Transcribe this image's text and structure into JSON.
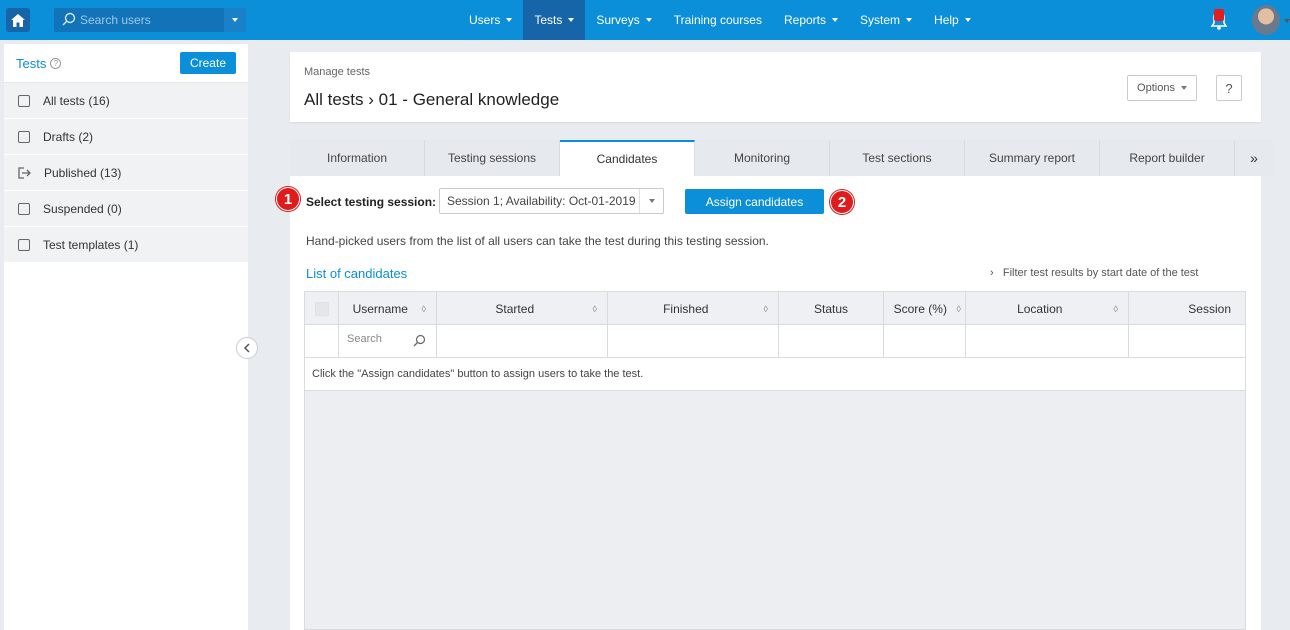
{
  "topbar": {
    "search_placeholder": "Search users",
    "nav": [
      {
        "label": "Users",
        "dropdown": true,
        "active": false
      },
      {
        "label": "Tests",
        "dropdown": true,
        "active": true
      },
      {
        "label": "Surveys",
        "dropdown": true,
        "active": false
      },
      {
        "label": "Training courses",
        "dropdown": false,
        "active": false
      },
      {
        "label": "Reports",
        "dropdown": true,
        "active": false
      },
      {
        "label": "System",
        "dropdown": true,
        "active": false
      },
      {
        "label": "Help",
        "dropdown": true,
        "active": false
      }
    ],
    "colors": {
      "bar": "#0a8fd8",
      "active": "#1565a8",
      "notification": "#e02020"
    }
  },
  "sidebar": {
    "title": "Tests",
    "create_label": "Create",
    "items": [
      {
        "label": "All tests (16)",
        "icon": "all-tests-icon"
      },
      {
        "label": "Drafts (2)",
        "icon": "pencil-icon"
      },
      {
        "label": "Published (13)",
        "icon": "publish-icon"
      },
      {
        "label": "Suspended (0)",
        "icon": "pause-icon"
      },
      {
        "label": "Test templates (1)",
        "icon": "template-icon"
      }
    ]
  },
  "header": {
    "breadcrumb_small": "Manage tests",
    "breadcrumb_parent": "All tests",
    "breadcrumb_separator": "›",
    "breadcrumb_current": "01 - General knowledge",
    "options_label": "Options",
    "help_label": "?"
  },
  "tabs": {
    "items": [
      "Information",
      "Testing sessions",
      "Candidates",
      "Monitoring",
      "Test sections",
      "Summary report",
      "Report builder"
    ],
    "active": "Candidates",
    "more_label": "»"
  },
  "candidates": {
    "badge1": "1",
    "badge2": "2",
    "select_label": "Select testing session:",
    "session_value": "Session 1; Availability: Oct-01-2019",
    "assign_label": "Assign candidates",
    "description": "Hand-picked users from the list of all users can take the test during this testing session.",
    "list_title": "List of candidates",
    "filter_arrow": "›",
    "filter_label": "Filter test results by start date of the test",
    "columns": [
      "Username",
      "Started",
      "Finished",
      "Status",
      "Score (%)",
      "Location",
      "Session"
    ],
    "search_placeholder": "Search",
    "empty_message": "Click the \"Assign candidates\" button to assign users to take the test."
  }
}
